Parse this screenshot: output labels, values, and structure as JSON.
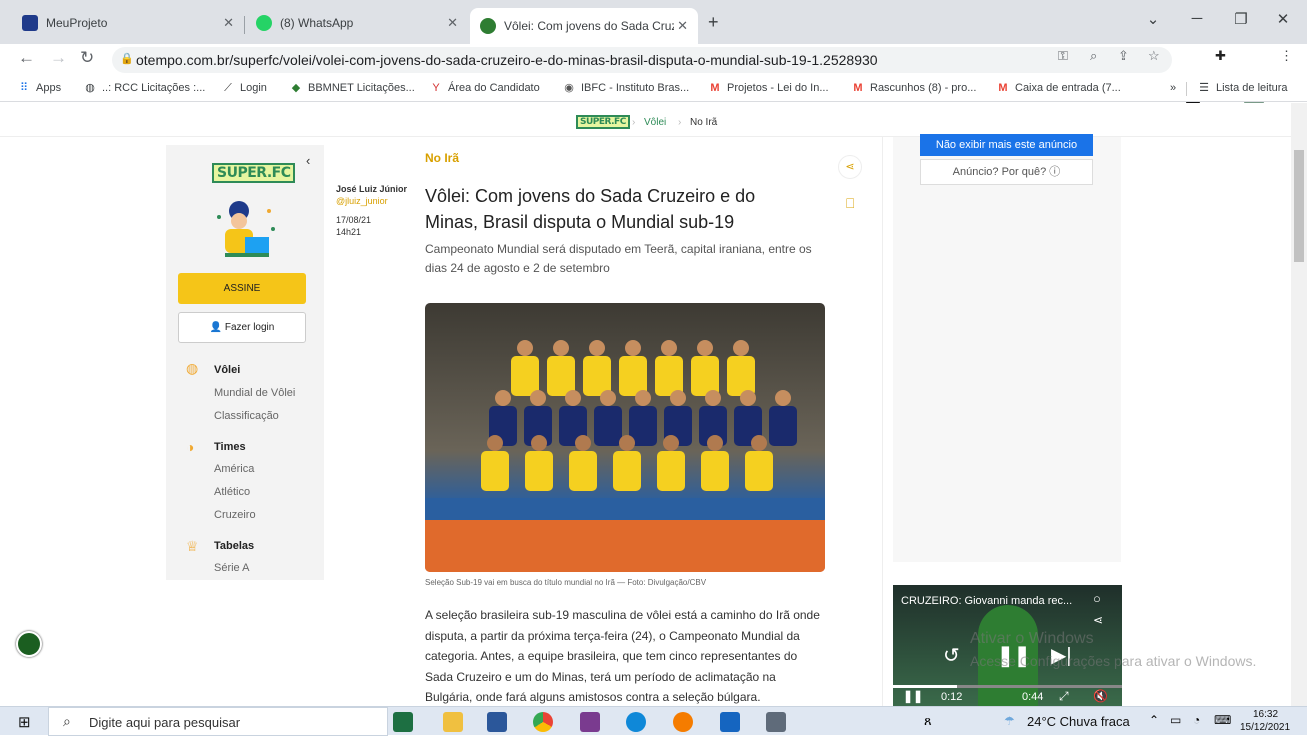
{
  "tabs": [
    {
      "title": "MeuProjeto",
      "active": false
    },
    {
      "title": "(8) WhatsApp",
      "active": false
    },
    {
      "title": "Vôlei: Com jovens do Sada Cruze",
      "active": true
    }
  ],
  "address": {
    "url": "otempo.com.br/superfc/volei/volei-com-jovens-do-sada-cruzeiro-e-do-minas-brasil-disputa-o-mundial-sub-19-1.2528930"
  },
  "bookmarks": {
    "apps": "Apps",
    "items": [
      "..: RCC Licitações :...",
      "Login",
      "BBMNET Licitações...",
      "Área do Candidato",
      "IBFC - Instituto Bras...",
      "Projetos - Lei do In...",
      "Rascunhos (8) - pro...",
      "Caixa de entrada (7..."
    ],
    "more": "»",
    "reading_list": "Lista de leitura"
  },
  "breadcrumb": {
    "logo": "SUPER.FC",
    "section": "Vôlei",
    "sub": "No Irã"
  },
  "sidebar": {
    "logo": "SUPER.FC",
    "subscribe": "ASSINE",
    "login": "Fazer login",
    "sections": [
      {
        "title": "Vôlei",
        "items": [
          "Mundial de Vôlei",
          "Classificação"
        ]
      },
      {
        "title": "Times",
        "items": [
          "América",
          "Atlético",
          "Cruzeiro"
        ]
      },
      {
        "title": "Tabelas",
        "items": [
          "Série A"
        ]
      }
    ]
  },
  "author": {
    "name": "José Luiz Júnior",
    "handle": "@jluiz_junior",
    "date": "17/08/21",
    "time": "14h21"
  },
  "article": {
    "kicker": "No Irã",
    "title": "Vôlei: Com jovens do Sada Cruzeiro e do Minas, Brasil disputa o Mundial sub-19",
    "subtitle": "Campeonato Mundial será disputado em Teerã, capital iraniana, entre os dias 24 de agosto e 2 de setembro",
    "caption": "Seleção Sub-19 vai em busca do título mundial no Irã — Foto: Divulgação/CBV",
    "body": "A seleção brasileira sub-19 masculina de vôlei está a caminho do Irã onde disputa, a partir da próxima terça-feira (24), o Campeonato Mundial da categoria. Antes, a equipe brasileira, que tem cinco representantes do Sada Cruzeiro e um do Minas, terá um período de aclimatação na Bulgária, onde fará alguns amistosos contra a seleção búlgara."
  },
  "ad": {
    "hide": "Não exibir mais este anúncio",
    "why": "Anúncio? Por quê? ⓘ"
  },
  "video": {
    "title": "CRUZEIRO: Giovanni manda rec...",
    "time_left": "0:12",
    "time_right": "0:44"
  },
  "watermark": {
    "line1": "Ativar o Windows",
    "line2": "Acesse Configurações para ativar o Windows."
  },
  "taskbar": {
    "search": "Digite aqui para pesquisar",
    "weather": "24°C  Chuva fraca",
    "time": "16:32",
    "date": "15/12/2021"
  },
  "colors": {
    "accent_green": "#2e8b57",
    "kicker": "#d8a000",
    "subscribe": "#f5c518",
    "ad_blue": "#1a73e8"
  }
}
